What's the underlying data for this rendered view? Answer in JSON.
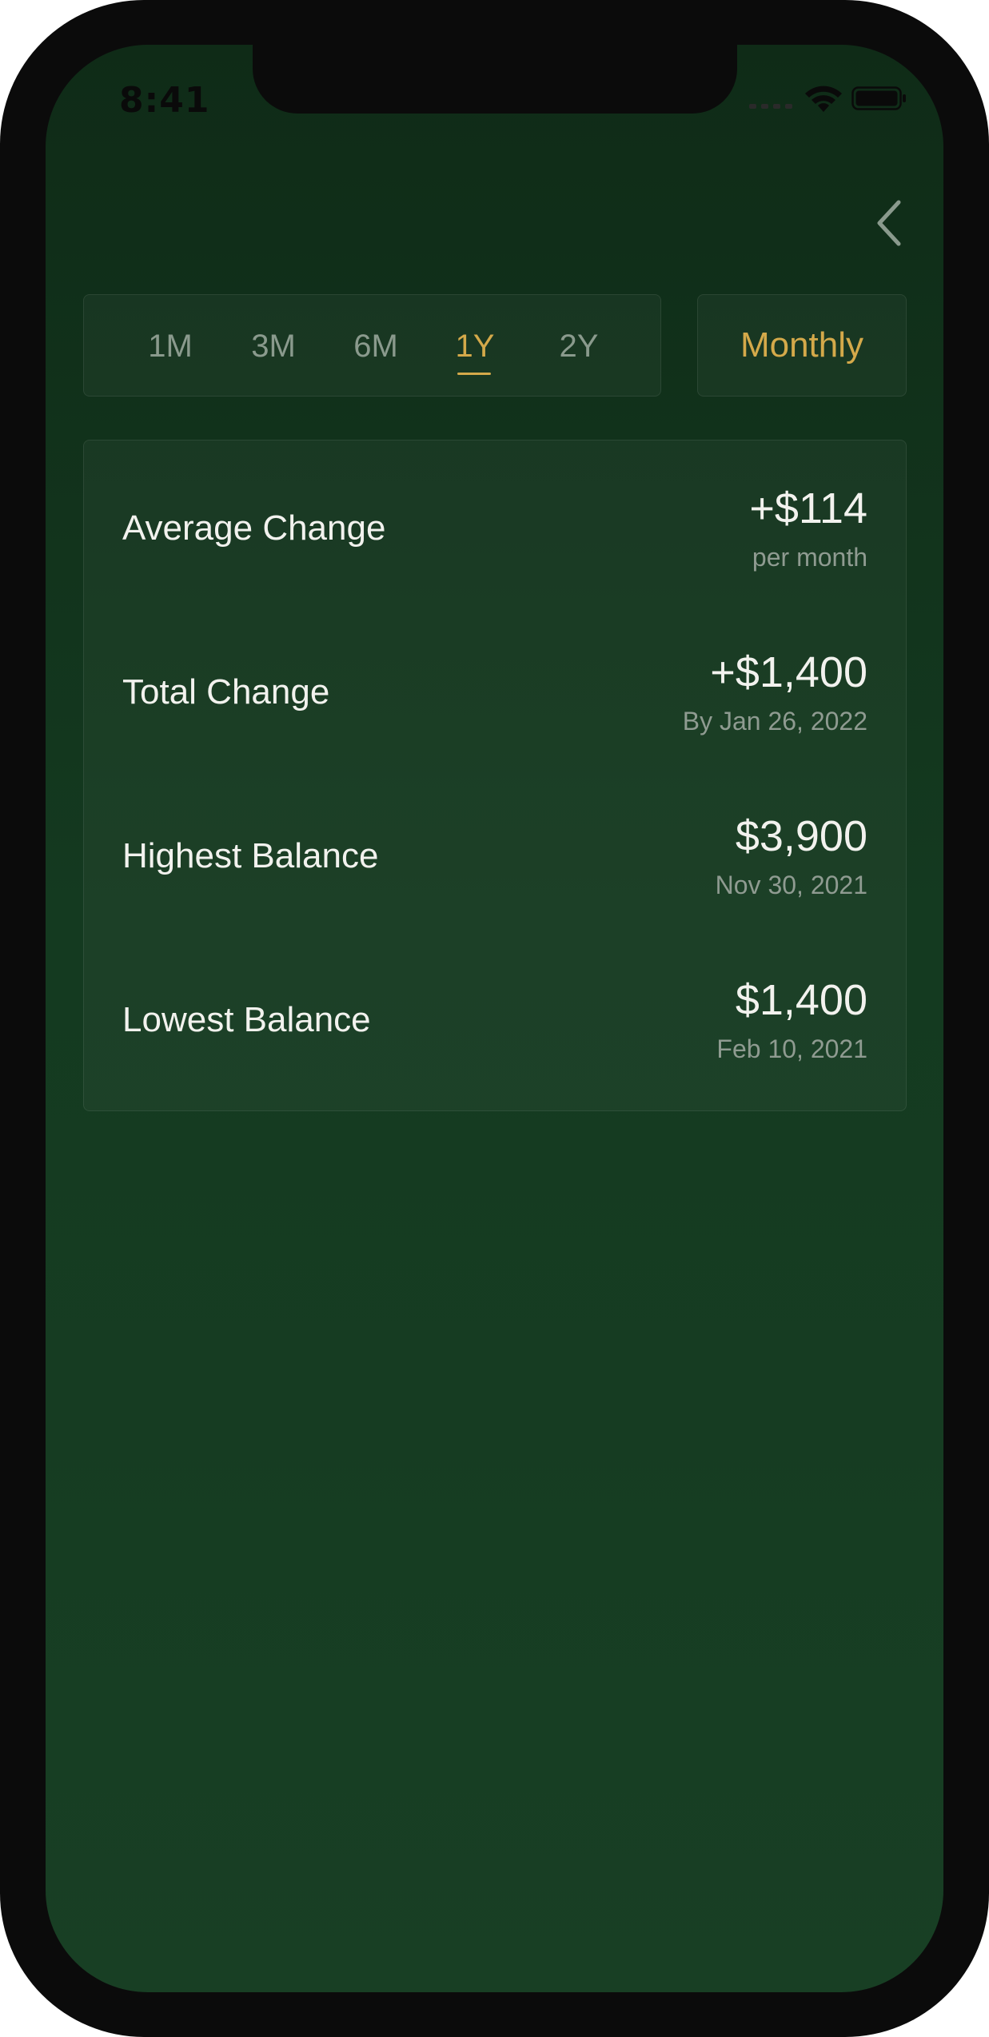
{
  "status_bar": {
    "time": "8:41"
  },
  "nav": {
    "back_icon": "chevron-left-icon"
  },
  "period_tabs": [
    {
      "label": "1M",
      "active": false
    },
    {
      "label": "3M",
      "active": false
    },
    {
      "label": "6M",
      "active": false
    },
    {
      "label": "1Y",
      "active": true
    },
    {
      "label": "2Y",
      "active": false
    }
  ],
  "frequency": {
    "label": "Monthly"
  },
  "stats": [
    {
      "label": "Average Change",
      "value": "+$114",
      "sub": "per month"
    },
    {
      "label": "Total Change",
      "value": "+$1,400",
      "sub": "By Jan 26, 2022"
    },
    {
      "label": "Highest Balance",
      "value": "$3,900",
      "sub": "Nov 30, 2021"
    },
    {
      "label": "Lowest Balance",
      "value": "$1,400",
      "sub": "Feb 10, 2021"
    }
  ],
  "colors": {
    "background": "#143a20",
    "accent": "#d4a94a",
    "text_primary": "#f2f2ee",
    "text_secondary": "#8f9b91"
  }
}
